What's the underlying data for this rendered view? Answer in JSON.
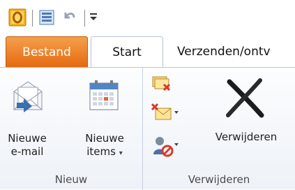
{
  "ribbon_tabs": {
    "file": "Bestand",
    "start": "Start",
    "send": "Verzenden/ontv"
  },
  "group_new": {
    "label": "Nieuw",
    "new_email_line1": "Nieuwe",
    "new_email_line2": "e-mail",
    "new_items_line1": "Nieuwe",
    "new_items_line2": "items",
    "dropdown_glyph": "▾"
  },
  "group_delete": {
    "label": "Verwijderen",
    "delete_button": "Verwijderen"
  },
  "colors": {
    "file_tab": "#e56a10",
    "ribbon_bg": "#eef2f8",
    "outlook_icon": "#f0a30a"
  }
}
